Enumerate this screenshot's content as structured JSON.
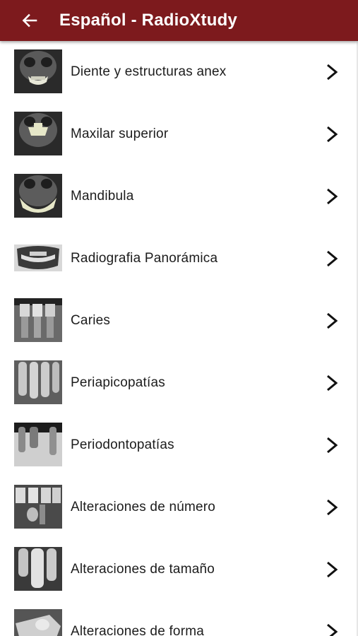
{
  "header": {
    "title": "Español - RadioXtudy",
    "background": "#7d1a1d"
  },
  "items": [
    {
      "label": "Diente y estructuras anex",
      "thumb": "skull-frontal-teeth-xray"
    },
    {
      "label": "Maxilar superior",
      "thumb": "skull-frontal-maxilla-xray"
    },
    {
      "label": "Mandibula",
      "thumb": "skull-frontal-mandible-xray"
    },
    {
      "label": "Radiografia Panorámica",
      "thumb": "panoramic-xray"
    },
    {
      "label": "Caries",
      "thumb": "bitewing-xray"
    },
    {
      "label": "Periapicopatías",
      "thumb": "periapical-xray"
    },
    {
      "label": "Periodontopatías",
      "thumb": "periodontal-xray"
    },
    {
      "label": "Alteraciones de número",
      "thumb": "tooth-number-xray"
    },
    {
      "label": "Alteraciones de tamaño",
      "thumb": "tooth-size-xray"
    },
    {
      "label": "Alteraciones de forma",
      "thumb": "tooth-shape-xray"
    }
  ]
}
